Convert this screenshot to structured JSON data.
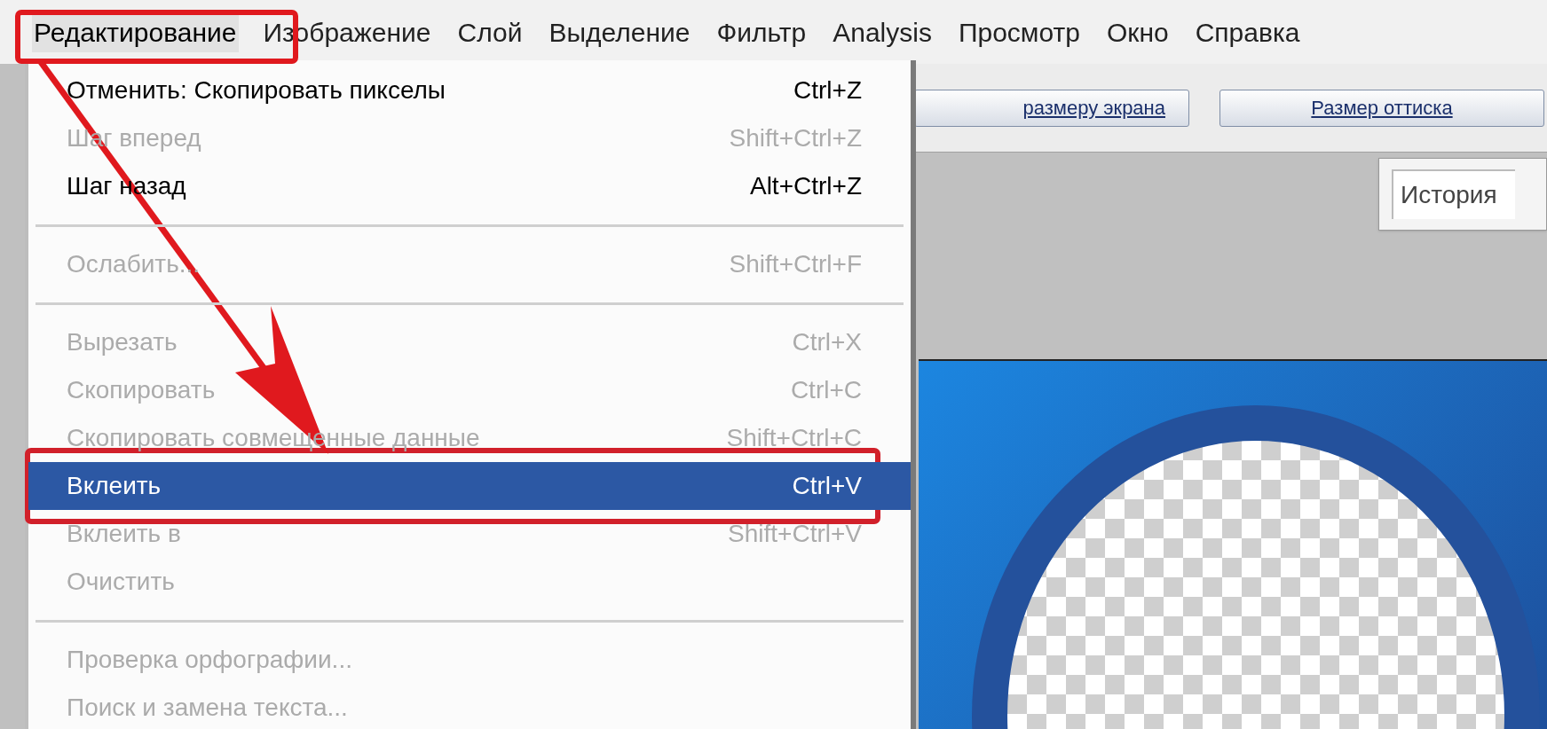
{
  "menu_bar": {
    "items": [
      {
        "label": "Редактирование",
        "highlighted": true
      },
      {
        "label": "Изображение",
        "highlighted": false
      },
      {
        "label": "Слой",
        "highlighted": false
      },
      {
        "label": "Выделение",
        "highlighted": false
      },
      {
        "label": "Фильтр",
        "highlighted": false
      },
      {
        "label": "Analysis",
        "highlighted": false
      },
      {
        "label": "Просмотр",
        "highlighted": false
      },
      {
        "label": "Окно",
        "highlighted": false
      },
      {
        "label": "Справка",
        "highlighted": false
      }
    ]
  },
  "dropdown_menu": {
    "items": [
      {
        "kind": "item",
        "label": "Отменить: Скопировать пикселы",
        "shortcut": "Ctrl+Z",
        "disabled": false,
        "selected": false
      },
      {
        "kind": "item",
        "label": "Шаг вперед",
        "shortcut": "Shift+Ctrl+Z",
        "disabled": true,
        "selected": false
      },
      {
        "kind": "item",
        "label": "Шаг назад",
        "shortcut": "Alt+Ctrl+Z",
        "disabled": false,
        "selected": false
      },
      {
        "kind": "separator"
      },
      {
        "kind": "item",
        "label": "Ослабить...",
        "shortcut": "Shift+Ctrl+F",
        "disabled": true,
        "selected": false
      },
      {
        "kind": "separator"
      },
      {
        "kind": "item",
        "label": "Вырезать",
        "shortcut": "Ctrl+X",
        "disabled": true,
        "selected": false
      },
      {
        "kind": "item",
        "label": "Скопировать",
        "shortcut": "Ctrl+C",
        "disabled": true,
        "selected": false
      },
      {
        "kind": "item",
        "label": "Скопировать совмещенные данные",
        "shortcut": "Shift+Ctrl+C",
        "disabled": true,
        "selected": false
      },
      {
        "kind": "item",
        "label": "Вклеить",
        "shortcut": "Ctrl+V",
        "disabled": false,
        "selected": true
      },
      {
        "kind": "item",
        "label": "Вклеить в",
        "shortcut": "Shift+Ctrl+V",
        "disabled": true,
        "selected": false
      },
      {
        "kind": "item",
        "label": "Очистить",
        "disabled": true,
        "selected": false
      },
      {
        "kind": "separator"
      },
      {
        "kind": "item",
        "label": "Проверка орфографии...",
        "disabled": true,
        "selected": false
      },
      {
        "kind": "item",
        "label": "Поиск и замена текста...",
        "disabled": true,
        "selected": false
      }
    ]
  },
  "toolbar": {
    "buttons": [
      "размеру экрана",
      "Размер оттиска"
    ]
  },
  "panel": {
    "tab": "История"
  }
}
